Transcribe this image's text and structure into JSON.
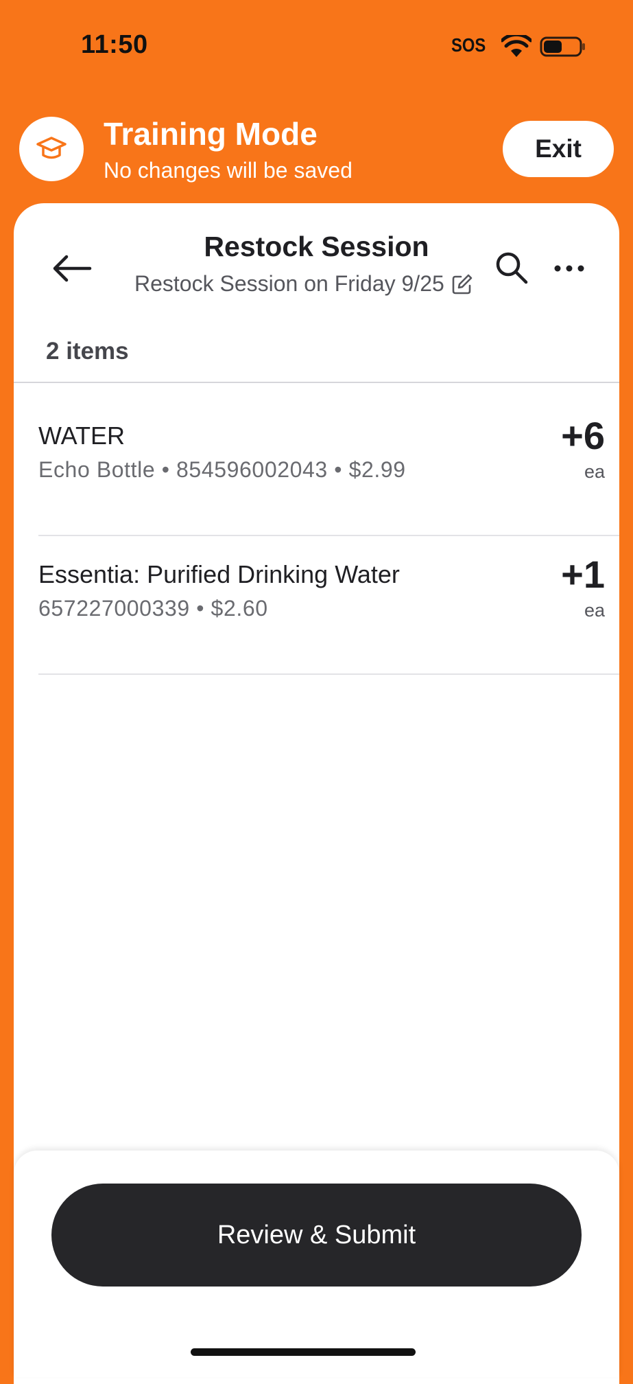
{
  "status_bar": {
    "time": "11:50",
    "sos": "SOS",
    "icons": [
      "wifi-icon",
      "battery-icon"
    ]
  },
  "training": {
    "icon": "graduation-cap-icon",
    "title": "Training Mode",
    "subtitle": "No changes will be saved",
    "exit_label": "Exit"
  },
  "header": {
    "title": "Restock Session",
    "subtitle": "Restock Session on Friday 9/25",
    "icons": [
      "back-arrow-icon",
      "edit-icon",
      "search-icon",
      "more-icon"
    ]
  },
  "list": {
    "count_label": "2 items",
    "items": [
      {
        "name": "WATER",
        "detail": "Echo Bottle • 854596002043 • $2.99",
        "quantity": "+6",
        "unit": "ea"
      },
      {
        "name": "Essentia: Purified Drinking Water",
        "detail": "657227000339 • $2.60",
        "quantity": "+1",
        "unit": "ea"
      }
    ]
  },
  "footer": {
    "submit_label": "Review & Submit"
  },
  "colors": {
    "brand_orange": "#F87519",
    "card_white": "#FFFFFF",
    "button_dark": "#262629"
  }
}
